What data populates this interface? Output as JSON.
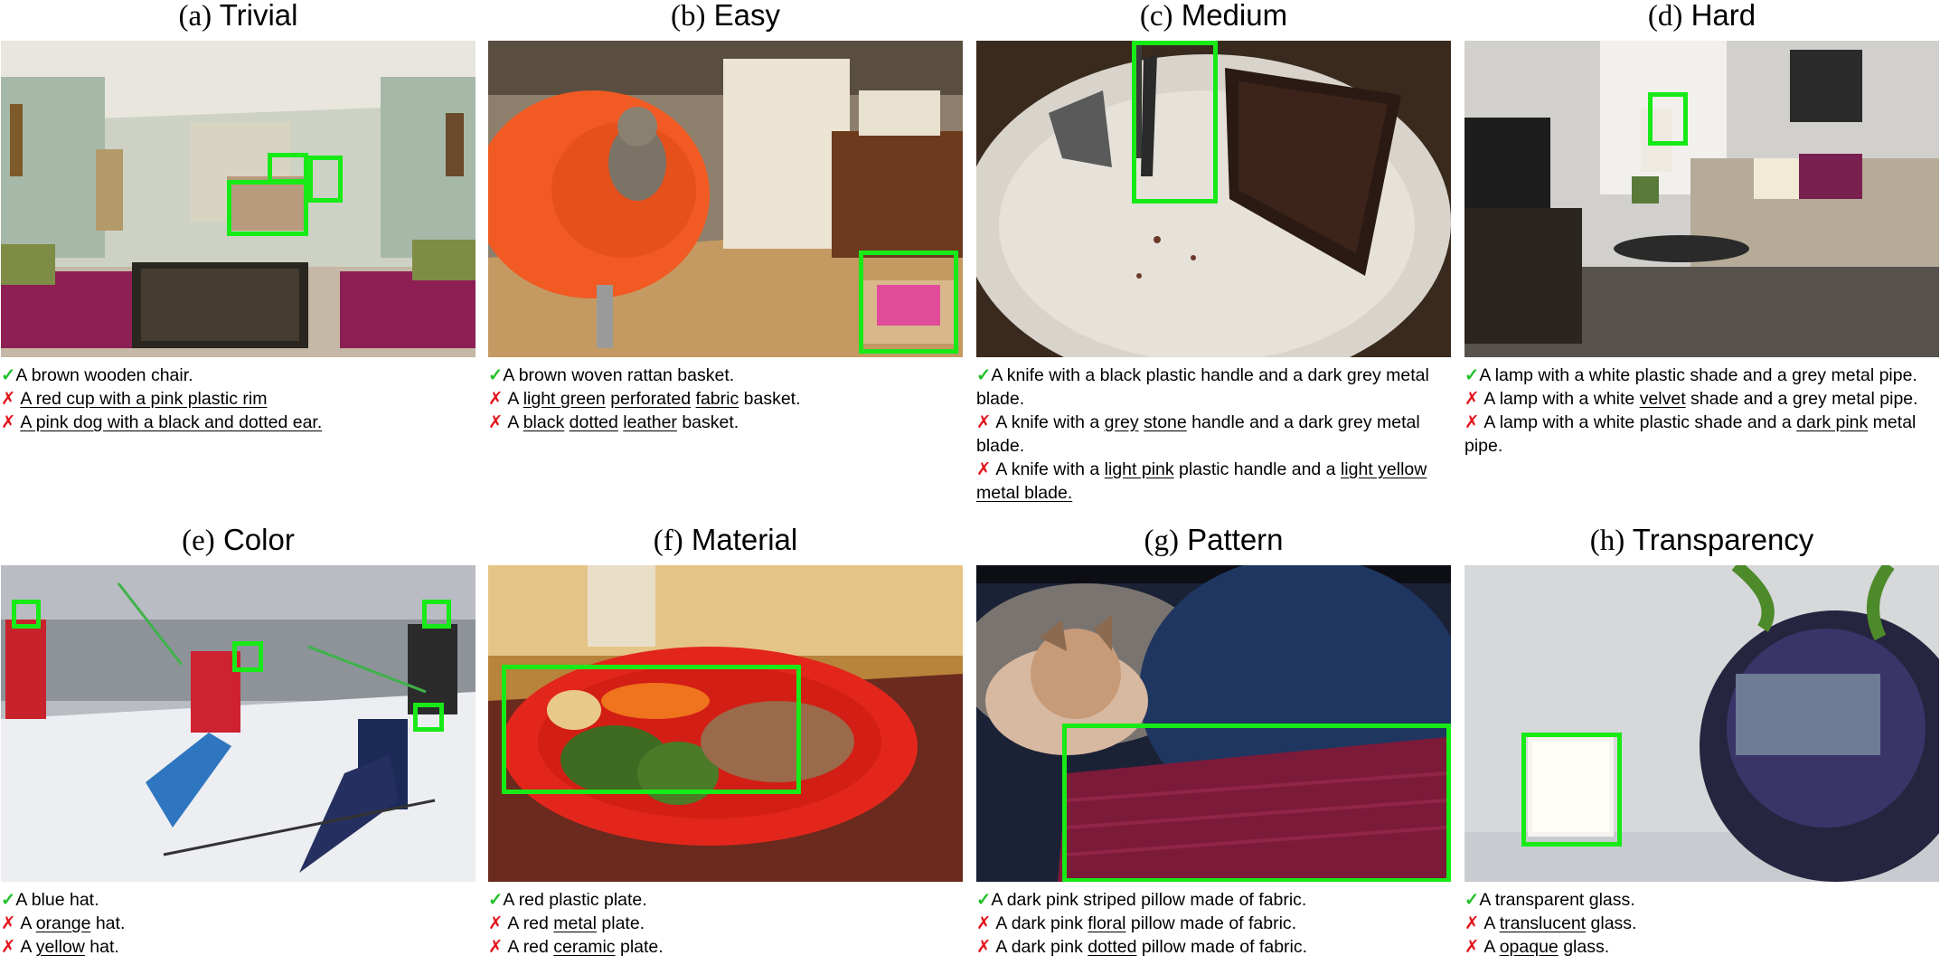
{
  "panels": [
    {
      "label": "(a)",
      "name": "Trivial",
      "captions": [
        {
          "mark": "✓",
          "ok": true,
          "parts": [
            [
              "A brown wooden chair.",
              false
            ]
          ]
        },
        {
          "mark": "✗",
          "ok": false,
          "parts": [
            [
              "A red cup with a pink plastic rim",
              true
            ]
          ]
        },
        {
          "mark": "✗",
          "ok": false,
          "parts": [
            [
              "A pink dog with a black and dotted ear.",
              true
            ]
          ]
        }
      ]
    },
    {
      "label": "(b)",
      "name": "Easy",
      "captions": [
        {
          "mark": "✓",
          "ok": true,
          "parts": [
            [
              "A brown woven rattan basket.",
              false
            ]
          ]
        },
        {
          "mark": "✗",
          "ok": false,
          "parts": [
            [
              "A ",
              false
            ],
            [
              "light green",
              true
            ],
            [
              " ",
              false
            ],
            [
              "perforated",
              true
            ],
            [
              " ",
              false
            ],
            [
              "fabric",
              true
            ],
            [
              " basket.",
              false
            ]
          ]
        },
        {
          "mark": "✗",
          "ok": false,
          "parts": [
            [
              "A ",
              false
            ],
            [
              "black",
              true
            ],
            [
              " ",
              false
            ],
            [
              "dotted",
              true
            ],
            [
              " ",
              false
            ],
            [
              "leather",
              true
            ],
            [
              " basket.",
              false
            ]
          ]
        }
      ]
    },
    {
      "label": "(c)",
      "name": "Medium",
      "captions": [
        {
          "mark": "✓",
          "ok": true,
          "parts": [
            [
              "A knife with a black plastic handle and a dark grey metal blade.",
              false
            ]
          ]
        },
        {
          "mark": "✗",
          "ok": false,
          "parts": [
            [
              "A knife with a ",
              false
            ],
            [
              "grey",
              true
            ],
            [
              " ",
              false
            ],
            [
              "stone",
              true
            ],
            [
              " handle and a dark grey metal blade.",
              false
            ]
          ]
        },
        {
          "mark": "✗",
          "ok": false,
          "parts": [
            [
              "A knife with a ",
              false
            ],
            [
              "light pink",
              true
            ],
            [
              " plastic handle and a ",
              false
            ],
            [
              "light yellow",
              true
            ],
            [
              " ",
              false
            ],
            [
              "metal blade.",
              true
            ]
          ]
        }
      ]
    },
    {
      "label": "(d)",
      "name": "Hard",
      "captions": [
        {
          "mark": "✓",
          "ok": true,
          "parts": [
            [
              "A lamp with a white plastic shade and a grey metal pipe.",
              false
            ]
          ]
        },
        {
          "mark": "✗",
          "ok": false,
          "parts": [
            [
              "A lamp with a white ",
              false
            ],
            [
              "velvet",
              true
            ],
            [
              " shade and a grey metal pipe.",
              false
            ]
          ]
        },
        {
          "mark": "✗",
          "ok": false,
          "parts": [
            [
              "A lamp with a white plastic shade and a ",
              false
            ],
            [
              "dark pink",
              true
            ],
            [
              " metal pipe.",
              false
            ]
          ]
        }
      ]
    },
    {
      "label": "(e)",
      "name": "Color",
      "captions": [
        {
          "mark": "✓",
          "ok": true,
          "parts": [
            [
              "A blue hat.",
              false
            ]
          ]
        },
        {
          "mark": "✗",
          "ok": false,
          "parts": [
            [
              "A ",
              false
            ],
            [
              "orange",
              true
            ],
            [
              " hat.",
              false
            ]
          ]
        },
        {
          "mark": "✗",
          "ok": false,
          "parts": [
            [
              "A ",
              false
            ],
            [
              "yellow",
              true
            ],
            [
              " hat.",
              false
            ]
          ]
        }
      ]
    },
    {
      "label": "(f)",
      "name": "Material",
      "captions": [
        {
          "mark": "✓",
          "ok": true,
          "parts": [
            [
              "A red plastic plate.",
              false
            ]
          ]
        },
        {
          "mark": "✗",
          "ok": false,
          "parts": [
            [
              "A red ",
              false
            ],
            [
              "metal",
              true
            ],
            [
              " plate.",
              false
            ]
          ]
        },
        {
          "mark": "✗",
          "ok": false,
          "parts": [
            [
              "A red ",
              false
            ],
            [
              "ceramic",
              true
            ],
            [
              " plate.",
              false
            ]
          ]
        }
      ]
    },
    {
      "label": "(g)",
      "name": "Pattern",
      "captions": [
        {
          "mark": "✓",
          "ok": true,
          "parts": [
            [
              "A dark pink striped pillow made of fabric.",
              false
            ]
          ]
        },
        {
          "mark": "✗",
          "ok": false,
          "parts": [
            [
              "A dark pink ",
              false
            ],
            [
              "floral",
              true
            ],
            [
              " pillow made of fabric.",
              false
            ]
          ]
        },
        {
          "mark": "✗",
          "ok": false,
          "parts": [
            [
              "A dark pink ",
              false
            ],
            [
              "dotted",
              true
            ],
            [
              " pillow made of fabric.",
              false
            ]
          ]
        }
      ]
    },
    {
      "label": "(h)",
      "name": "Transparency",
      "captions": [
        {
          "mark": "✓",
          "ok": true,
          "parts": [
            [
              "A transparent glass.",
              false
            ]
          ]
        },
        {
          "mark": "✗",
          "ok": false,
          "parts": [
            [
              "A ",
              false
            ],
            [
              "translucent",
              true
            ],
            [
              " glass.",
              false
            ]
          ]
        },
        {
          "mark": "✗",
          "ok": false,
          "parts": [
            [
              "A ",
              false
            ],
            [
              "opaque",
              true
            ],
            [
              " glass.",
              false
            ]
          ]
        }
      ]
    }
  ],
  "colors": {
    "check": "#22c02a",
    "cross": "#e3131b",
    "box": "#17ea17"
  }
}
